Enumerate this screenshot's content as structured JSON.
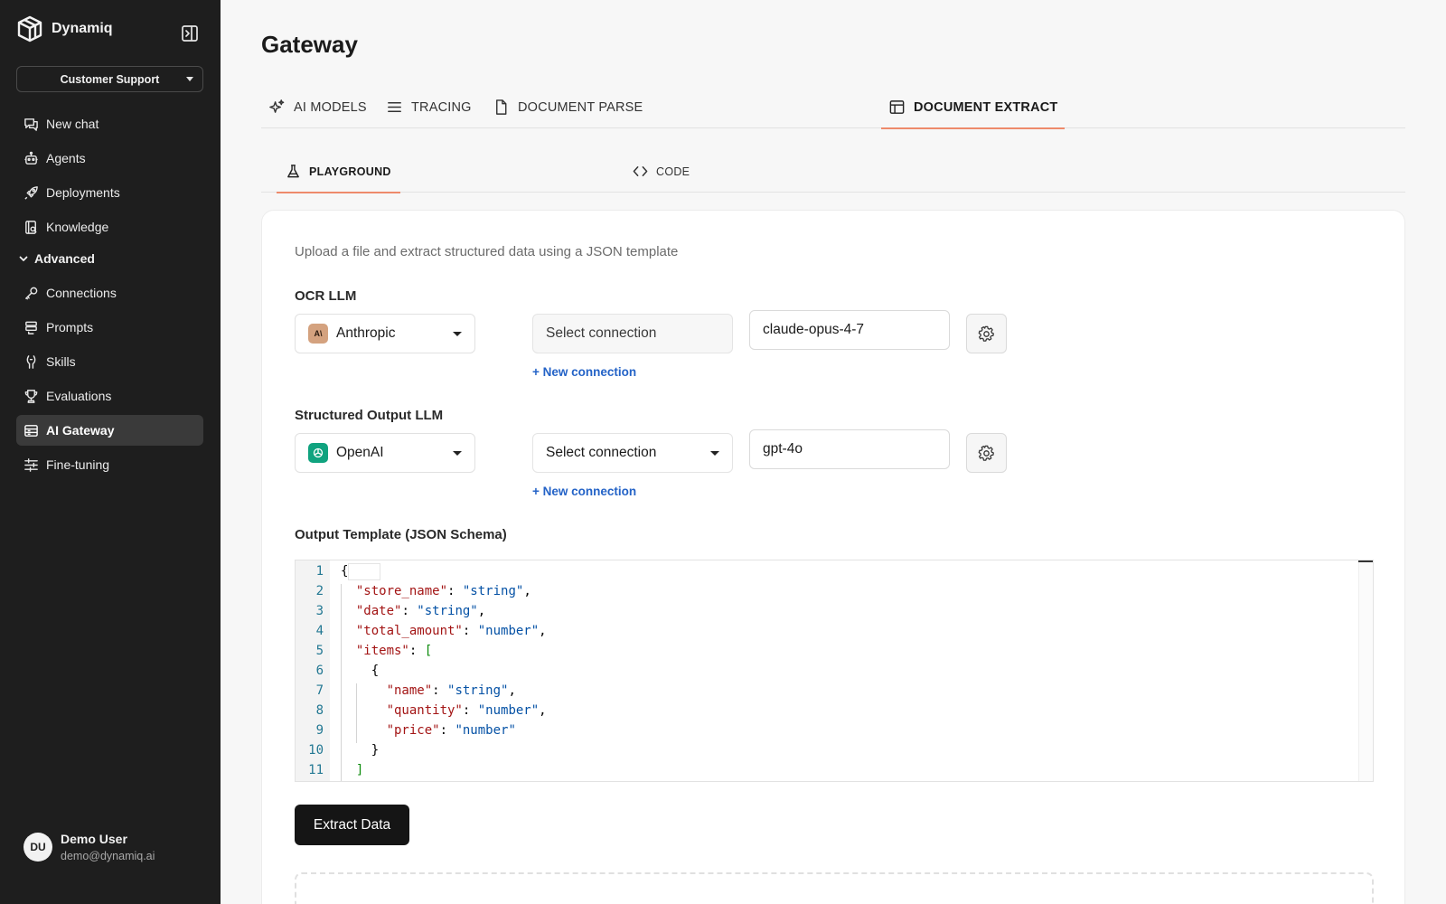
{
  "app": {
    "name": "Dynamiq",
    "workspace": "Customer Support"
  },
  "sidebar": {
    "items": [
      {
        "label": "New chat",
        "icon": "chat-icon"
      },
      {
        "label": "Agents",
        "icon": "robot-icon"
      },
      {
        "label": "Deployments",
        "icon": "rocket-icon"
      },
      {
        "label": "Knowledge",
        "icon": "book-icon"
      }
    ],
    "advanced_label": "Advanced",
    "advanced_items": [
      {
        "label": "Connections",
        "icon": "key-icon"
      },
      {
        "label": "Prompts",
        "icon": "prompts-icon"
      },
      {
        "label": "Skills",
        "icon": "skills-icon"
      },
      {
        "label": "Evaluations",
        "icon": "trophy-icon"
      },
      {
        "label": "AI Gateway",
        "icon": "gateway-icon",
        "active": true
      },
      {
        "label": "Fine-tuning",
        "icon": "sliders-icon"
      }
    ],
    "user": {
      "initials": "DU",
      "name": "Demo User",
      "email": "demo@dynamiq.ai"
    }
  },
  "main": {
    "title": "Gateway",
    "tabs": [
      {
        "label": "AI MODELS",
        "icon": "sparkles-icon"
      },
      {
        "label": "TRACING",
        "icon": "list-icon"
      },
      {
        "label": "DOCUMENT PARSE",
        "icon": "document-icon"
      },
      {
        "label": "DOCUMENT EXTRACT",
        "icon": "table-icon",
        "active": true
      }
    ],
    "subtabs": [
      {
        "label": "PLAYGROUND",
        "icon": "flask-icon",
        "active": true
      },
      {
        "label": "CODE",
        "icon": "code-icon"
      }
    ]
  },
  "form": {
    "description": "Upload a file and extract structured data using a JSON template",
    "ocr": {
      "label": "OCR LLM",
      "provider": "Anthropic",
      "provider_logo": "A\\",
      "connection_placeholder": "Select connection",
      "new_connection": "+ New connection",
      "model": "claude-opus-4-7"
    },
    "structured": {
      "label": "Structured Output LLM",
      "provider": "OpenAI",
      "connection_placeholder": "Select connection",
      "new_connection": "+ New connection",
      "model": "gpt-4o"
    },
    "template_label": "Output Template (JSON Schema)",
    "extract_button": "Extract Data"
  },
  "editor": {
    "line_numbers": [
      "1",
      "2",
      "3",
      "4",
      "5",
      "6",
      "7",
      "8",
      "9",
      "10",
      "11"
    ],
    "lines": [
      "{",
      "  \"store_name\": \"string\",",
      "  \"date\": \"string\",",
      "  \"total_amount\": \"number\",",
      "  \"items\": [",
      "    {",
      "      \"name\": \"string\",",
      "      \"quantity\": \"number\",",
      "      \"price\": \"number\"",
      "    }",
      "  ]"
    ]
  },
  "colors": {
    "sidebar_bg": "#1e1e1e",
    "accent_tab": "#ee8a6b",
    "link": "#2463c7",
    "anthropic_logo_bg": "#d4a27f",
    "openai_logo_bg": "#10a37f"
  }
}
